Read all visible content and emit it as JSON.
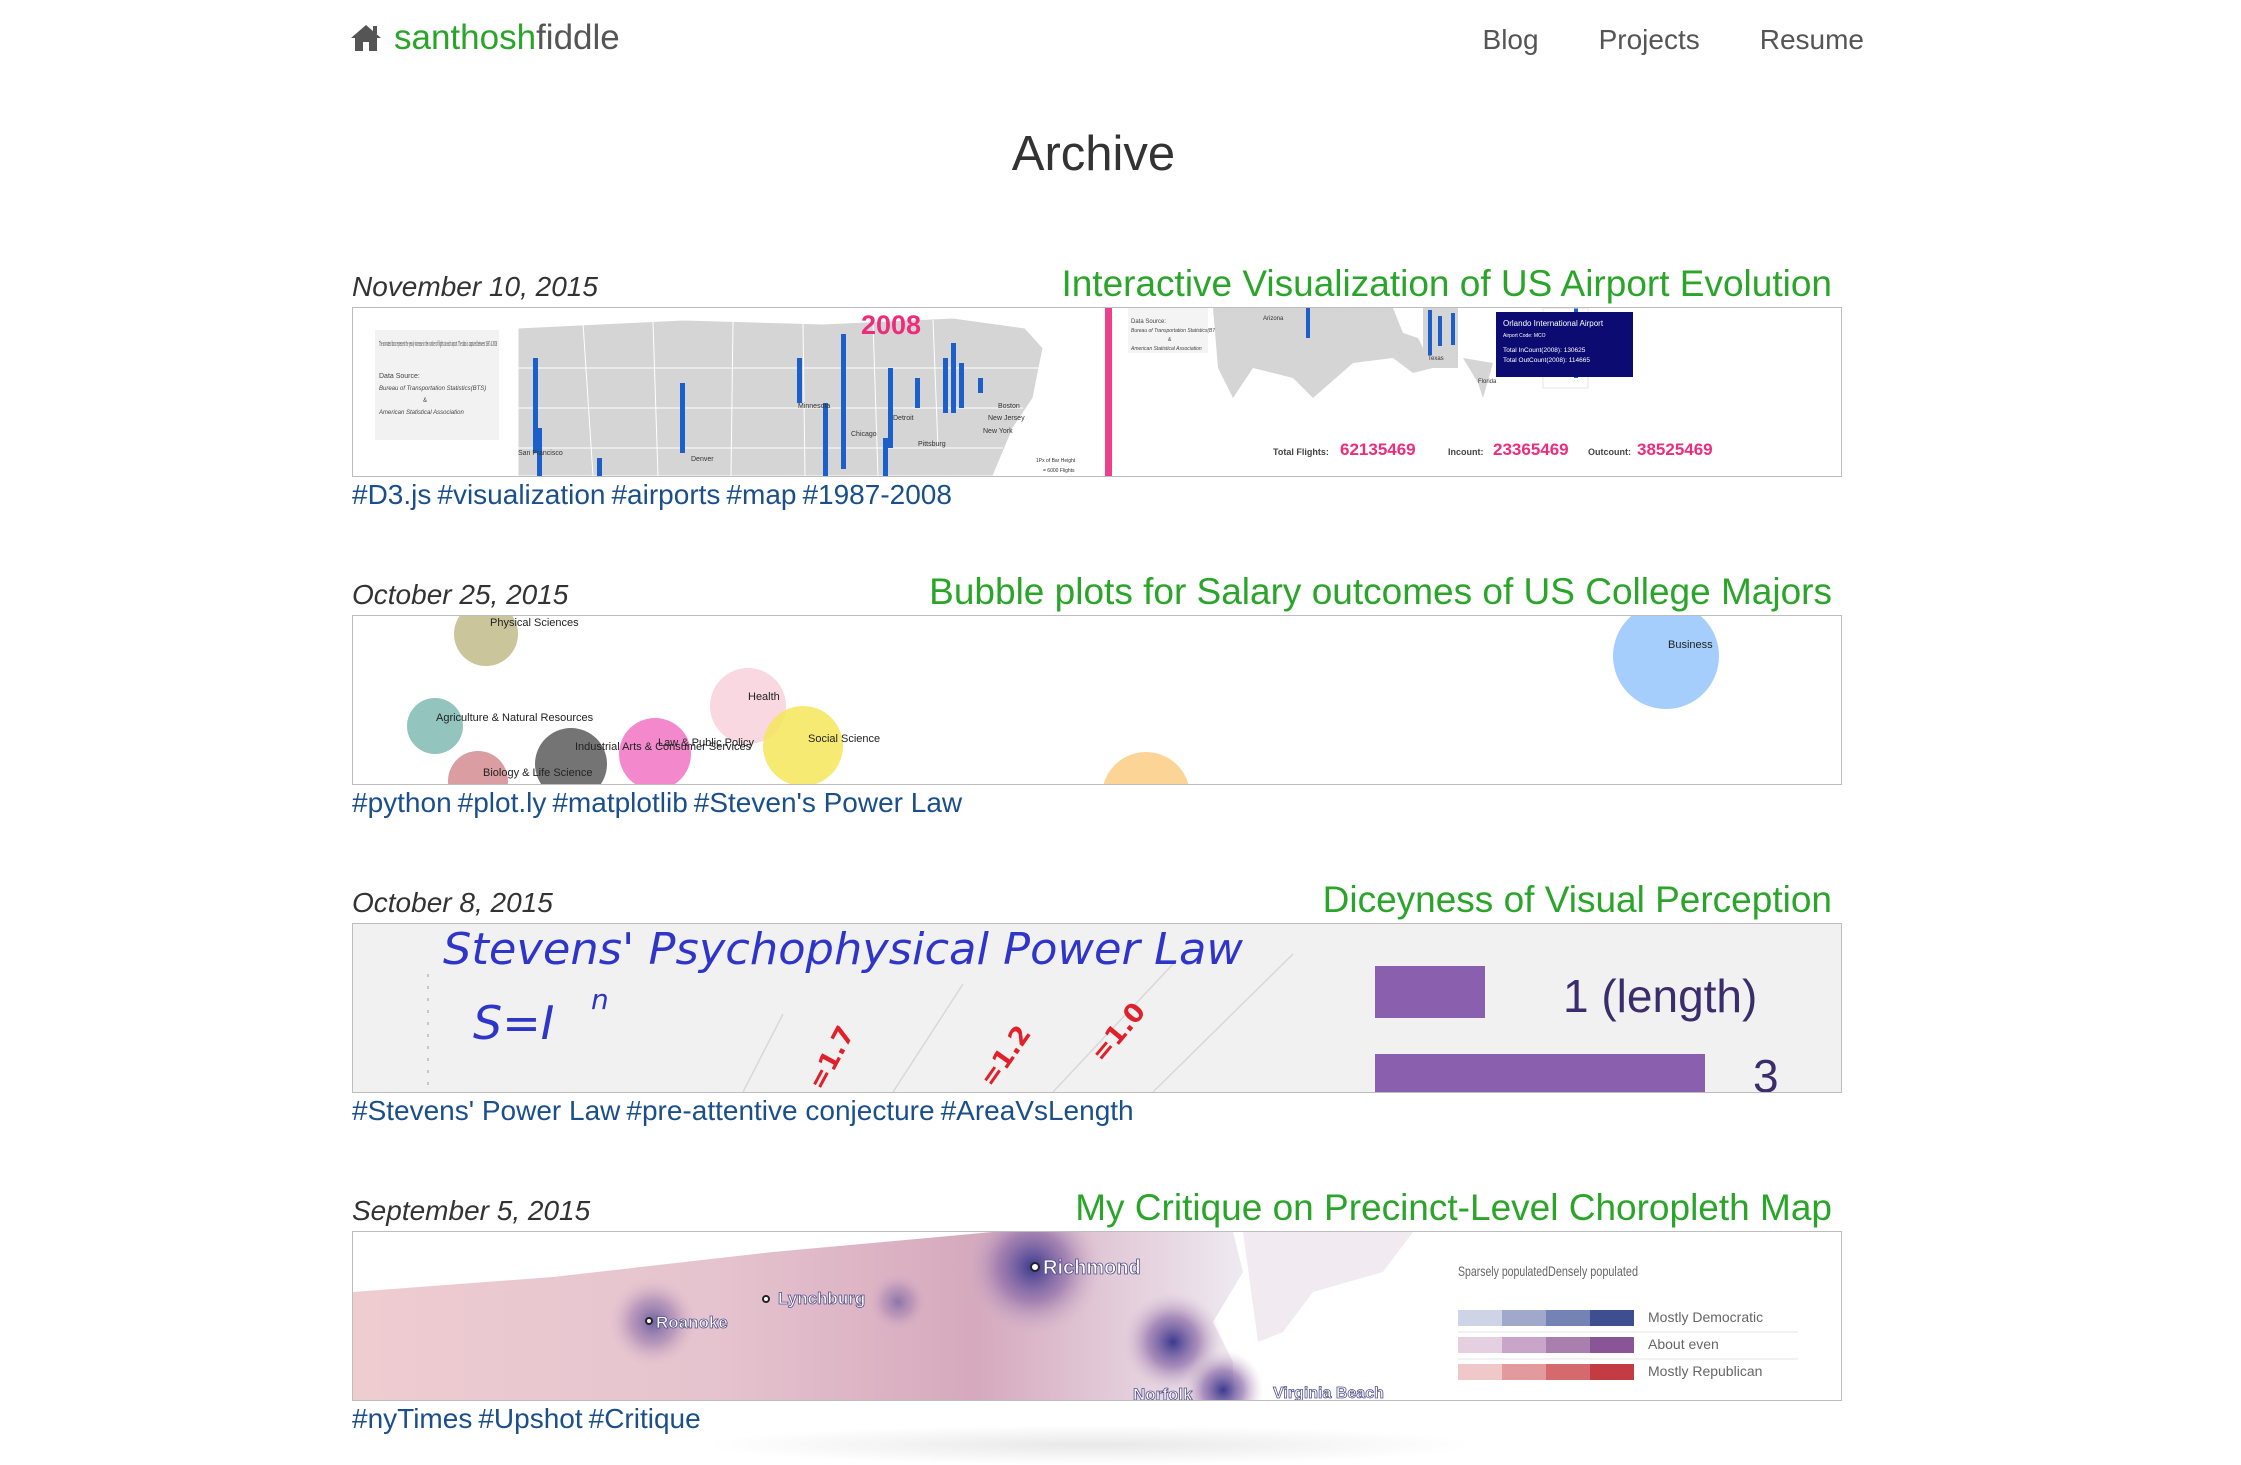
{
  "nav": {
    "brand_part1": "santhosh",
    "brand_part2": "fiddle",
    "links": [
      "Blog",
      "Projects",
      "Resume"
    ],
    "brand_icon": "home-icon"
  },
  "page_title": "Archive",
  "colors": {
    "brand_green": "#2aa52a",
    "tag_blue": "#1a4f8c",
    "text": "#333333"
  },
  "posts": [
    {
      "date": "November 10, 2015",
      "title": "Interactive Visualization of US Airport Evolution",
      "tags": [
        "#D3.js",
        "#visualization",
        "#airports",
        "#map",
        "#1987-2008"
      ],
      "thumb": {
        "year": "2008",
        "intro": "The animated bars represent the yearly increase in the number of flights at each airport. The data is captured between 1987 & 2008",
        "data_source_label": "Data Source:",
        "data_source_1": "Bureau of Transportation Statistics(BTS)",
        "data_source_amp": "&",
        "data_source_2": "American Statistical Association",
        "cities_left": [
          "San Francisco",
          "Denver",
          "Minnesota",
          "Chicago",
          "Detroit",
          "Pittsburg",
          "Boston",
          "New Jersey",
          "New York"
        ],
        "cities_right": [
          "Arizona",
          "Texas",
          "Florida"
        ],
        "legend_1": "1Px of Bar Height",
        "legend_2": "= 6000 Flights",
        "tooltip_title": "Orlando International Airport",
        "tooltip_code": "Airport Code: MCO",
        "tooltip_in": "Total InCount(2008): 130625",
        "tooltip_out": "Total OutCount(2008): 114665",
        "total_flights_label": "Total Flights:",
        "total_flights": "62135469",
        "incount_label": "Incount:",
        "incount": "23365469",
        "outcount_label": "Outcount:",
        "outcount": "38525469"
      }
    },
    {
      "date": "October 25, 2015",
      "title": "Bubble plots for Salary outcomes of US College Majors",
      "tags": [
        "#python",
        "#plot.ly",
        "#matplotlib",
        "#Steven's Power Law"
      ],
      "thumb": {
        "labels": [
          "Physical Sciences",
          "Business",
          "Health",
          "Agriculture & Natural Resources",
          "Social Science",
          "Industrial Arts & Consumer Services",
          "Law & Public Policy",
          "Biology & Life Science"
        ]
      }
    },
    {
      "date": "October 8, 2015",
      "title": "Diceyness of Visual Perception",
      "tags": [
        "#Stevens' Power Law",
        "#pre-attentive conjecture",
        "#AreaVsLength"
      ],
      "thumb": {
        "heading": "Stevens' Psychophysical Power Law",
        "formula": "S=I",
        "exponent": "n",
        "exp_labels": [
          "=1.7",
          "=1.2",
          "=1.0"
        ],
        "bar_label_1": "1 (length)",
        "bar_label_2": "3",
        "bar_value_1": 1,
        "bar_value_2": 3
      }
    },
    {
      "date": "September 5, 2015",
      "title": "My Critique on Precinct-Level Choropleth Map",
      "tags": [
        "#nyTimes",
        "#Upshot",
        "#Critique"
      ],
      "thumb": {
        "cities": [
          "Richmond",
          "Lynchburg",
          "Roanoke",
          "Norfolk",
          "Virginia Beach"
        ],
        "legend_sparse": "Sparsely populated",
        "legend_dense": "Densely populated",
        "legend_dem": "Mostly Democratic",
        "legend_even": "About even",
        "legend_rep": "Mostly Republican"
      }
    }
  ]
}
